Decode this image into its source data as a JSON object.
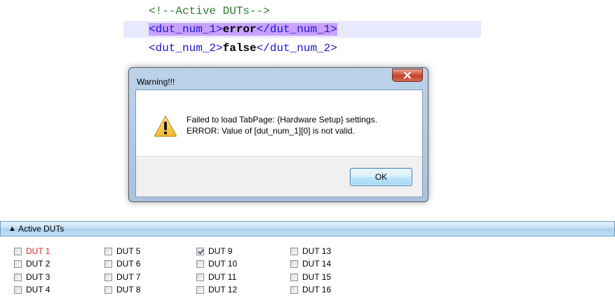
{
  "editor": {
    "comment": "<!--Active DUTs-->",
    "line2": {
      "open_tag": "<dut_num_1>",
      "value": "error",
      "close_tag_a": "</dut_",
      "close_tag_b": "num_1>"
    },
    "line3": {
      "open_tag": "<dut_num_2>",
      "value": "false",
      "close_tag": "</dut_num_2>"
    }
  },
  "dialog": {
    "title": "Warning!!!",
    "message_line1": "Failed to load TabPage: {Hardware Setup} settings.",
    "message_line2": "ERROR: Value of [dut_num_1][0] is not valid.",
    "ok_label": "OK",
    "icon": "warning-icon",
    "close_icon": "close-icon"
  },
  "panel": {
    "arrow": "▲",
    "title": "Active DUTs"
  },
  "duts": [
    {
      "label": "DUT 1",
      "checked": false,
      "error": true
    },
    {
      "label": "DUT 2",
      "checked": false,
      "error": false
    },
    {
      "label": "DUT 3",
      "checked": false,
      "error": false
    },
    {
      "label": "DUT 4",
      "checked": false,
      "error": false
    },
    {
      "label": "DUT 5",
      "checked": false,
      "error": false
    },
    {
      "label": "DUT 6",
      "checked": false,
      "error": false
    },
    {
      "label": "DUT 7",
      "checked": false,
      "error": false
    },
    {
      "label": "DUT 8",
      "checked": false,
      "error": false
    },
    {
      "label": "DUT 9",
      "checked": true,
      "error": false
    },
    {
      "label": "DUT 10",
      "checked": false,
      "error": false
    },
    {
      "label": "DUT 11",
      "checked": false,
      "error": false
    },
    {
      "label": "DUT 12",
      "checked": false,
      "error": false
    },
    {
      "label": "DUT 13",
      "checked": false,
      "error": false
    },
    {
      "label": "DUT 14",
      "checked": false,
      "error": false
    },
    {
      "label": "DUT 15",
      "checked": false,
      "error": false
    },
    {
      "label": "DUT 16",
      "checked": false,
      "error": false
    }
  ],
  "colors": {
    "error_text": "#e02020",
    "selection": "#c9a2ff",
    "xml_tag": "#1a1ad0",
    "xml_comment": "#2e7d32"
  }
}
